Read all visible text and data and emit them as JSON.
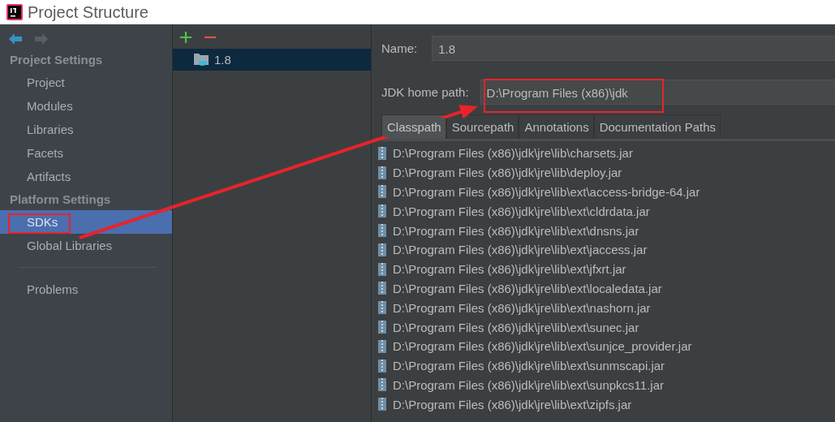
{
  "window": {
    "title": "Project Structure"
  },
  "sidebar": {
    "groups": [
      {
        "heading": "Project Settings",
        "items": [
          {
            "label": "Project",
            "selected": false,
            "boxed": false
          },
          {
            "label": "Modules",
            "selected": false,
            "boxed": false
          },
          {
            "label": "Libraries",
            "selected": false,
            "boxed": false
          },
          {
            "label": "Facets",
            "selected": false,
            "boxed": false
          },
          {
            "label": "Artifacts",
            "selected": false,
            "boxed": false
          }
        ]
      },
      {
        "heading": "Platform Settings",
        "items": [
          {
            "label": "SDKs",
            "selected": true,
            "boxed": true
          },
          {
            "label": "Global Libraries",
            "selected": false,
            "boxed": false
          }
        ]
      }
    ],
    "footer_items": [
      {
        "label": "Problems",
        "selected": false
      }
    ]
  },
  "sdk_list": {
    "items": [
      {
        "label": "1.8",
        "selected": true
      }
    ]
  },
  "detail": {
    "name_label": "Name:",
    "name_value": "1.8",
    "home_label": "JDK home path:",
    "home_value": "D:\\Program Files (x86)\\jdk",
    "home_boxed": true,
    "tabs": [
      {
        "label": "Classpath",
        "selected": true
      },
      {
        "label": "Sourcepath",
        "selected": false
      },
      {
        "label": "Annotations",
        "selected": false
      },
      {
        "label": "Documentation Paths",
        "selected": false
      }
    ],
    "paths": [
      "D:\\Program Files (x86)\\jdk\\jre\\lib\\charsets.jar",
      "D:\\Program Files (x86)\\jdk\\jre\\lib\\deploy.jar",
      "D:\\Program Files (x86)\\jdk\\jre\\lib\\ext\\access-bridge-64.jar",
      "D:\\Program Files (x86)\\jdk\\jre\\lib\\ext\\cldrdata.jar",
      "D:\\Program Files (x86)\\jdk\\jre\\lib\\ext\\dnsns.jar",
      "D:\\Program Files (x86)\\jdk\\jre\\lib\\ext\\jaccess.jar",
      "D:\\Program Files (x86)\\jdk\\jre\\lib\\ext\\jfxrt.jar",
      "D:\\Program Files (x86)\\jdk\\jre\\lib\\ext\\localedata.jar",
      "D:\\Program Files (x86)\\jdk\\jre\\lib\\ext\\nashorn.jar",
      "D:\\Program Files (x86)\\jdk\\jre\\lib\\ext\\sunec.jar",
      "D:\\Program Files (x86)\\jdk\\jre\\lib\\ext\\sunjce_provider.jar",
      "D:\\Program Files (x86)\\jdk\\jre\\lib\\ext\\sunmscapi.jar",
      "D:\\Program Files (x86)\\jdk\\jre\\lib\\ext\\sunpkcs11.jar",
      "D:\\Program Files (x86)\\jdk\\jre\\lib\\ext\\zipfs.jar"
    ]
  },
  "annotation_arrow": true
}
